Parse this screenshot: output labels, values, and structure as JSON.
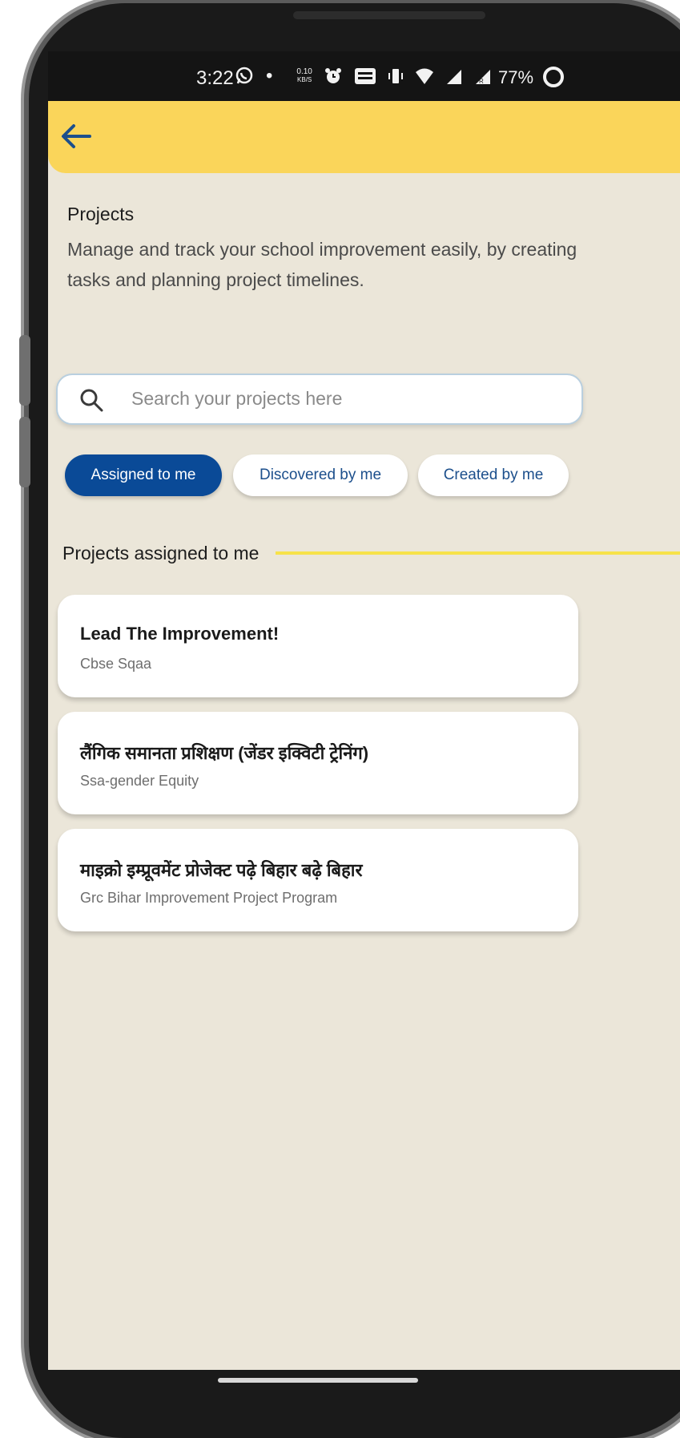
{
  "status_bar": {
    "time": "3:22",
    "net_speed_top": "0.10",
    "net_speed_bottom": "KB/S",
    "battery": "77%"
  },
  "header": {
    "back_icon": "arrow-left-icon"
  },
  "page": {
    "title": "Projects",
    "subtitle": "Manage and track your school improvement easily, by creating tasks and planning project timelines."
  },
  "search": {
    "placeholder": "Search your projects here",
    "icon": "search-icon"
  },
  "filters": [
    {
      "label": "Assigned to me",
      "active": true
    },
    {
      "label": "Discovered by me",
      "active": false
    },
    {
      "label": "Created by me",
      "active": false
    }
  ],
  "section": {
    "title": "Projects assigned to me"
  },
  "projects": [
    {
      "title": "Lead The Improvement!",
      "subtitle": "Cbse Sqaa"
    },
    {
      "title": "लैंगिक समानता प्रशिक्षण (जेंडर इक्विटी ट्रेनिंग)",
      "subtitle": "Ssa-gender Equity"
    },
    {
      "title": "माइक्रो इम्प्रूवमेंट प्रोजेक्ट पढ़े बिहार बढ़े बिहार",
      "subtitle": "Grc Bihar Improvement Project Program"
    }
  ],
  "colors": {
    "header": "#fad55a",
    "background": "#ebe6d9",
    "active_chip": "#0a4a97",
    "chip_text": "#1c4f8c",
    "section_line": "#f7e24a",
    "accent_arrow": "#1c4f8c"
  }
}
